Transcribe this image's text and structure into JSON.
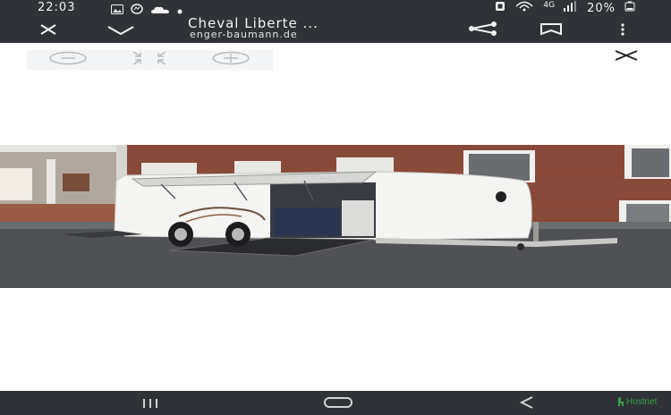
{
  "status_bar": {
    "time": "22:03",
    "left_icons": [
      "gallery-icon",
      "messenger-icon",
      "cloud-icon",
      "dot-icon"
    ],
    "right_icons": [
      "sim-icon",
      "hotspot-icon",
      "network-type-icon",
      "signal-icon",
      "battery-icon"
    ],
    "network_type": "4G",
    "battery_percent": "20%"
  },
  "toolbar": {
    "title": "Cheval Liberte ...",
    "url": "enger-baumann.de",
    "close_icon": "close-icon",
    "collapse_icon": "chevron-down-icon",
    "share_icon": "share-icon",
    "bookmark_icon": "bookmark-icon",
    "menu_icon": "more-vert-icon"
  },
  "viewer": {
    "zoom_out_icon": "zoom-out-icon",
    "fit_icon": "fit-screen-icon",
    "zoom_in_icon": "zoom-in-icon",
    "close_icon": "close-icon"
  },
  "image": {
    "subject": "white-horse-trailer",
    "colors": {
      "brick": "#8a4a3a",
      "trailer": "#f4f4f2",
      "road": "#4a4c50"
    }
  },
  "nav_bar": {
    "recents_icon": "recents-icon",
    "home_icon": "home-icon",
    "back_icon": "back-icon"
  },
  "watermark": {
    "text": "Hostnet",
    "color": "#3aa04a"
  }
}
